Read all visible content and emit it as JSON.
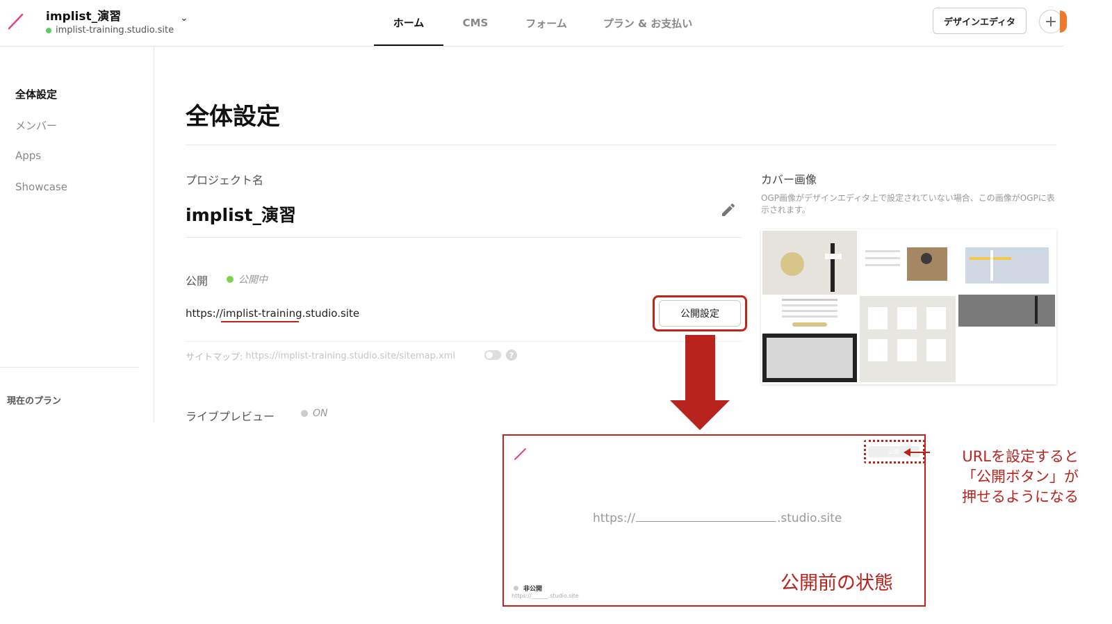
{
  "header": {
    "project_title": "implist_演習",
    "project_url": "implist-training.studio.site",
    "tabs": [
      {
        "label": "ホーム",
        "active": true
      },
      {
        "label": "CMS",
        "active": false
      },
      {
        "label": "フォーム",
        "active": false
      },
      {
        "label": "プラン & お支払い",
        "active": false
      }
    ],
    "design_editor_label": "デザインエディタ",
    "plus_label": "+"
  },
  "sidebar": {
    "items": [
      {
        "label": "全体設定",
        "active": true
      },
      {
        "label": "メンバー",
        "active": false
      },
      {
        "label": "Apps",
        "active": false
      },
      {
        "label": "Showcase",
        "active": false
      }
    ],
    "plan_label": "現在のプラン"
  },
  "main": {
    "title": "全体設定",
    "project_name_label": "プロジェクト名",
    "project_name": "implist_演習",
    "publish_label": "公開",
    "publish_status": "公開中",
    "site_url": "https://implist-training.studio.site",
    "publish_settings_button": "公開設定",
    "sitemap_label": "サイトマップ:",
    "sitemap_url": "https://implist-training.studio.site/sitemap.xml",
    "help_label": "?",
    "live_preview_label": "ライブプレビュー",
    "live_preview_status": "ON"
  },
  "cover": {
    "label": "カバー画像",
    "note": "OGP画像がデザインエディタ上で設定されていない場合、この画像がOGPに表示されます。"
  },
  "annotation": {
    "preview": {
      "button_label": "公開",
      "url_prefix": "https://",
      "url_suffix": ".studio.site",
      "caption": "公開前の状態",
      "status": "非公開",
      "small_url": "https://______.studio.site"
    },
    "note_lines": [
      "URLを設定すると",
      "「公開ボタン」が",
      "押せるようになる"
    ]
  },
  "colors": {
    "accent_red": "#b8241d",
    "status_green": "#7fd150",
    "logo_pink": "#e83e8c"
  },
  "icons": {
    "logo": "studio-slash-logo",
    "edit": "pencil-icon",
    "dropdown": "chevron-down-icon",
    "help": "help-icon",
    "add": "plus-icon"
  }
}
